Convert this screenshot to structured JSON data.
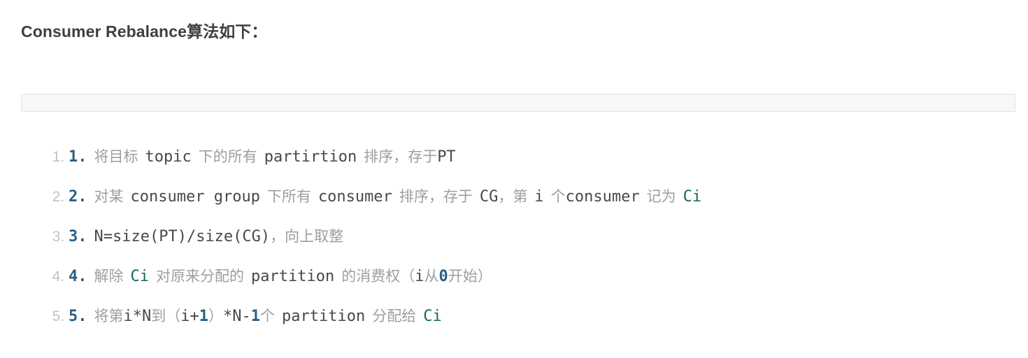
{
  "heading": "Consumer Rebalance算法如下：",
  "empty_box": {
    "content": ""
  },
  "colors": {
    "heading": "#3f3f3f",
    "marker": "#c2c2c2",
    "step_number": "#2a5f86",
    "chinese_text": "#9e9e9e",
    "code_text": "#494949",
    "identifier_teal": "#18665f",
    "numeric_literal": "#2a5f86",
    "box_background": "#f7f7f7",
    "box_border": "#e3e3e3"
  },
  "steps": [
    {
      "marker": "1.",
      "number": "1.",
      "text": "将目标 topic 下的所有 partirtion 排序，存于PT",
      "tokens": [
        {
          "t": "cn",
          "v": "将目标"
        },
        {
          "t": "sp",
          "v": " "
        },
        {
          "t": "code",
          "v": "topic"
        },
        {
          "t": "sp",
          "v": " "
        },
        {
          "t": "cn",
          "v": "下的所有"
        },
        {
          "t": "sp",
          "v": " "
        },
        {
          "t": "code",
          "v": "partirtion"
        },
        {
          "t": "sp",
          "v": " "
        },
        {
          "t": "cn",
          "v": "排序，存于"
        },
        {
          "t": "code",
          "v": "PT"
        }
      ]
    },
    {
      "marker": "2.",
      "number": "2.",
      "text": "对某 consumer group 下所有 consumer 排序，存于 CG，第 i 个consumer 记为 Ci",
      "tokens": [
        {
          "t": "cn",
          "v": "对某"
        },
        {
          "t": "sp",
          "v": " "
        },
        {
          "t": "code",
          "v": "consumer group"
        },
        {
          "t": "sp",
          "v": " "
        },
        {
          "t": "cn",
          "v": "下所有"
        },
        {
          "t": "sp",
          "v": " "
        },
        {
          "t": "code",
          "v": "consumer"
        },
        {
          "t": "sp",
          "v": " "
        },
        {
          "t": "cn",
          "v": "排序，存于"
        },
        {
          "t": "sp",
          "v": " "
        },
        {
          "t": "code",
          "v": "CG"
        },
        {
          "t": "cn",
          "v": "，第"
        },
        {
          "t": "sp",
          "v": " "
        },
        {
          "t": "code",
          "v": "i"
        },
        {
          "t": "sp",
          "v": " "
        },
        {
          "t": "cn",
          "v": "个"
        },
        {
          "t": "code",
          "v": "consumer"
        },
        {
          "t": "sp",
          "v": " "
        },
        {
          "t": "cn",
          "v": "记为"
        },
        {
          "t": "sp",
          "v": " "
        },
        {
          "t": "ci",
          "v": "Ci"
        }
      ]
    },
    {
      "marker": "3.",
      "number": "3.",
      "text": "N=size(PT)/size(CG)，向上取整",
      "tokens": [
        {
          "t": "code",
          "v": "N=size(PT)/size(CG)"
        },
        {
          "t": "cn",
          "v": "，向上取整"
        }
      ]
    },
    {
      "marker": "4.",
      "number": "4.",
      "text": "解除 Ci 对原来分配的 partition 的消费权（i从0开始）",
      "tokens": [
        {
          "t": "cn",
          "v": "解除"
        },
        {
          "t": "sp",
          "v": " "
        },
        {
          "t": "ci",
          "v": "Ci"
        },
        {
          "t": "sp",
          "v": " "
        },
        {
          "t": "cn",
          "v": "对原来分配的"
        },
        {
          "t": "sp",
          "v": " "
        },
        {
          "t": "code",
          "v": "partition"
        },
        {
          "t": "sp",
          "v": " "
        },
        {
          "t": "cn",
          "v": "的消费权（"
        },
        {
          "t": "code",
          "v": "i"
        },
        {
          "t": "cn",
          "v": "从"
        },
        {
          "t": "lit",
          "v": "0"
        },
        {
          "t": "cn",
          "v": "开始）"
        }
      ]
    },
    {
      "marker": "5.",
      "number": "5.",
      "text": "将第i*N到（i+1）*N-1个 partition 分配给 Ci",
      "tokens": [
        {
          "t": "cn",
          "v": "将第"
        },
        {
          "t": "code",
          "v": "i*N"
        },
        {
          "t": "cn",
          "v": "到（"
        },
        {
          "t": "code",
          "v": "i+"
        },
        {
          "t": "lit",
          "v": "1"
        },
        {
          "t": "cn",
          "v": "）"
        },
        {
          "t": "code",
          "v": "*N-"
        },
        {
          "t": "lit",
          "v": "1"
        },
        {
          "t": "cn",
          "v": "个"
        },
        {
          "t": "sp",
          "v": " "
        },
        {
          "t": "code",
          "v": "partition"
        },
        {
          "t": "sp",
          "v": " "
        },
        {
          "t": "cn",
          "v": "分配给"
        },
        {
          "t": "sp",
          "v": " "
        },
        {
          "t": "ci",
          "v": "Ci"
        }
      ]
    }
  ]
}
